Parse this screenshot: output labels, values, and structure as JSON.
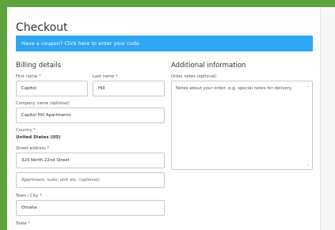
{
  "title": "Checkout",
  "coupon_notice": "Have a coupon? Click here to enter your code",
  "billing": {
    "heading": "Billing details",
    "first_name": {
      "label": "First name",
      "required_mark": "*",
      "value": "Capitol"
    },
    "last_name": {
      "label": "Last name",
      "required_mark": "*",
      "value": "Hill"
    },
    "company": {
      "label": "Company name (optional)",
      "value": "Capitol Hill Apartments"
    },
    "country": {
      "label": "Country",
      "required_mark": "*",
      "value": "United States (US)"
    },
    "street": {
      "label": "Street address",
      "required_mark": "*",
      "value": "320 North 22nd Street",
      "line2_placeholder": "Apartment, suite, unit etc. (optional)"
    },
    "city": {
      "label": "Town / City",
      "required_mark": "*",
      "value": "Omaha"
    },
    "state": {
      "label": "State",
      "required_mark": "*"
    }
  },
  "additional": {
    "heading": "Additional information",
    "notes_label": "Order notes (optional)",
    "notes_placeholder": "Notes about your order, e.g. special notes for delivery."
  },
  "colors": {
    "coupon_bg": "#2fa6f2",
    "frame": "#5fa33e",
    "required": "#e2401c"
  }
}
